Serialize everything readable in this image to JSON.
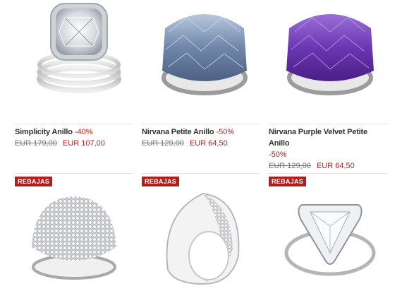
{
  "products": [
    {
      "name": "Simplicity Anillo",
      "discount": "-40%",
      "old_price": "EUR 179,00",
      "new_price": "EUR 107,00"
    },
    {
      "name": "Nirvana Petite Anillo",
      "discount": "-50%",
      "old_price": "EUR 129,00",
      "new_price": "EUR 64,50"
    },
    {
      "name": "Nirvana Purple Velvet Petite Anillo",
      "discount": "-50%",
      "old_price": "EUR 129,00",
      "new_price": "EUR 64,50"
    }
  ],
  "badges": [
    "REBAJAS",
    "REBAJAS",
    "REBAJAS"
  ],
  "colors": {
    "accent": "#c21b1b",
    "badge": "#b51c1c",
    "text": "#333333"
  }
}
